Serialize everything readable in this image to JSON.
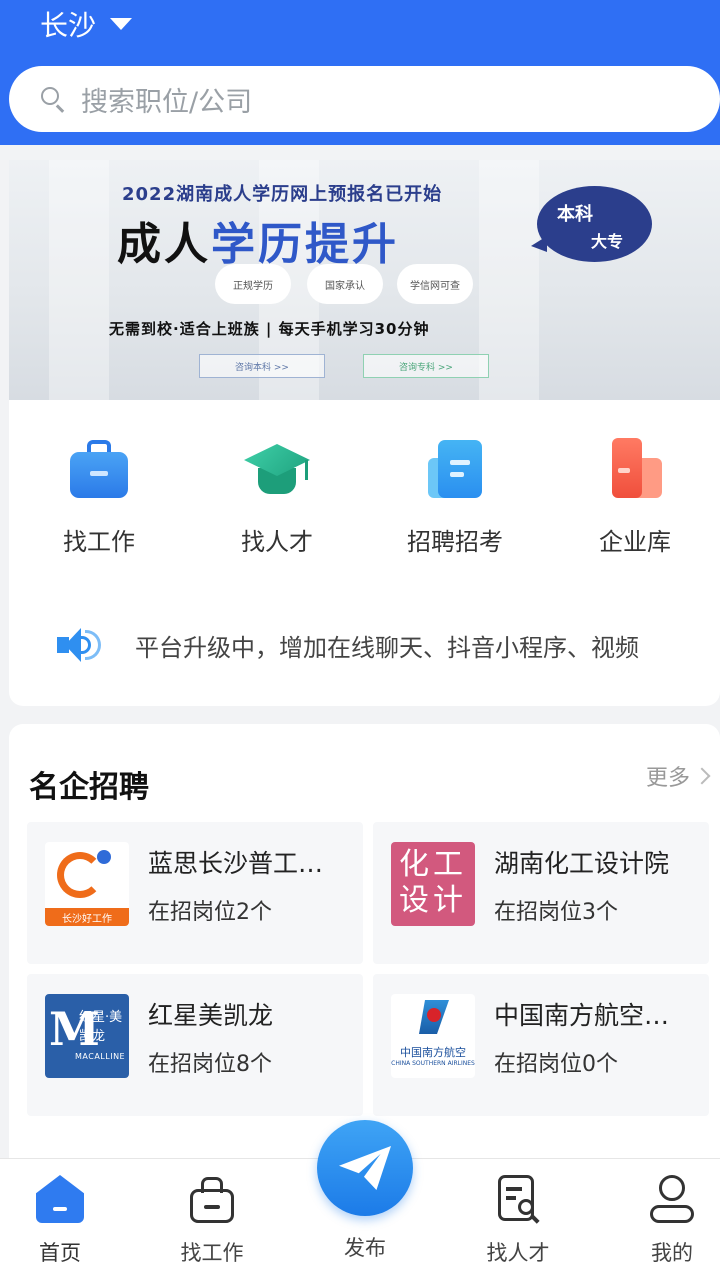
{
  "header": {
    "city": "长沙",
    "search_placeholder": "搜索职位/公司",
    "bg_color": "#2f6ff4"
  },
  "banner": {
    "subtitle": "2022湖南成人学历网上预报名已开始",
    "headline_dark": "成人",
    "headline_blue": "学历提升",
    "bubble_top": "本科",
    "bubble_bottom": "大专",
    "pills": [
      "正规学历",
      "国家承认",
      "学信网可查"
    ],
    "tagline": "无需到校·适合上班族 | 每天手机学习30分钟",
    "button_undergrad": "咨询本科 >>",
    "button_college": "咨询专科 >>"
  },
  "nav": {
    "items": [
      {
        "label": "找工作",
        "icon": "briefcase-icon"
      },
      {
        "label": "找人才",
        "icon": "graduation-cap-icon"
      },
      {
        "label": "招聘招考",
        "icon": "document-icon"
      },
      {
        "label": "企业库",
        "icon": "building-icon"
      }
    ]
  },
  "notice": {
    "icon": "speaker-icon",
    "text": "平台升级中，增加在线聊天、抖音小程序、视频"
  },
  "companies": {
    "title": "名企招聘",
    "more_label": "更多",
    "items": [
      {
        "name": "蓝思长沙普工…",
        "count": "在招岗位2个",
        "logo_text": "长沙好工作"
      },
      {
        "name": "湖南化工设计院",
        "count": "在招岗位3个",
        "logo_text": "化工设计"
      },
      {
        "name": "红星美凯龙",
        "count": "在招岗位8个",
        "logo_text": "红星·美凯龙",
        "logo_text_en": "MACALLINE"
      },
      {
        "name": "中国南方航空…",
        "count": "在招岗位0个",
        "logo_text": "中国南方航空",
        "logo_text_en": "CHINA SOUTHERN AIRLINES"
      }
    ]
  },
  "tabbar": {
    "items": [
      {
        "label": "首页",
        "icon": "home-icon",
        "active": true
      },
      {
        "label": "找工作",
        "icon": "briefcase-outline-icon"
      },
      {
        "label": "发布",
        "icon": "paper-plane-icon"
      },
      {
        "label": "找人才",
        "icon": "search-resume-icon"
      },
      {
        "label": "我的",
        "icon": "user-icon"
      }
    ],
    "accent": "#2f7bf0"
  }
}
